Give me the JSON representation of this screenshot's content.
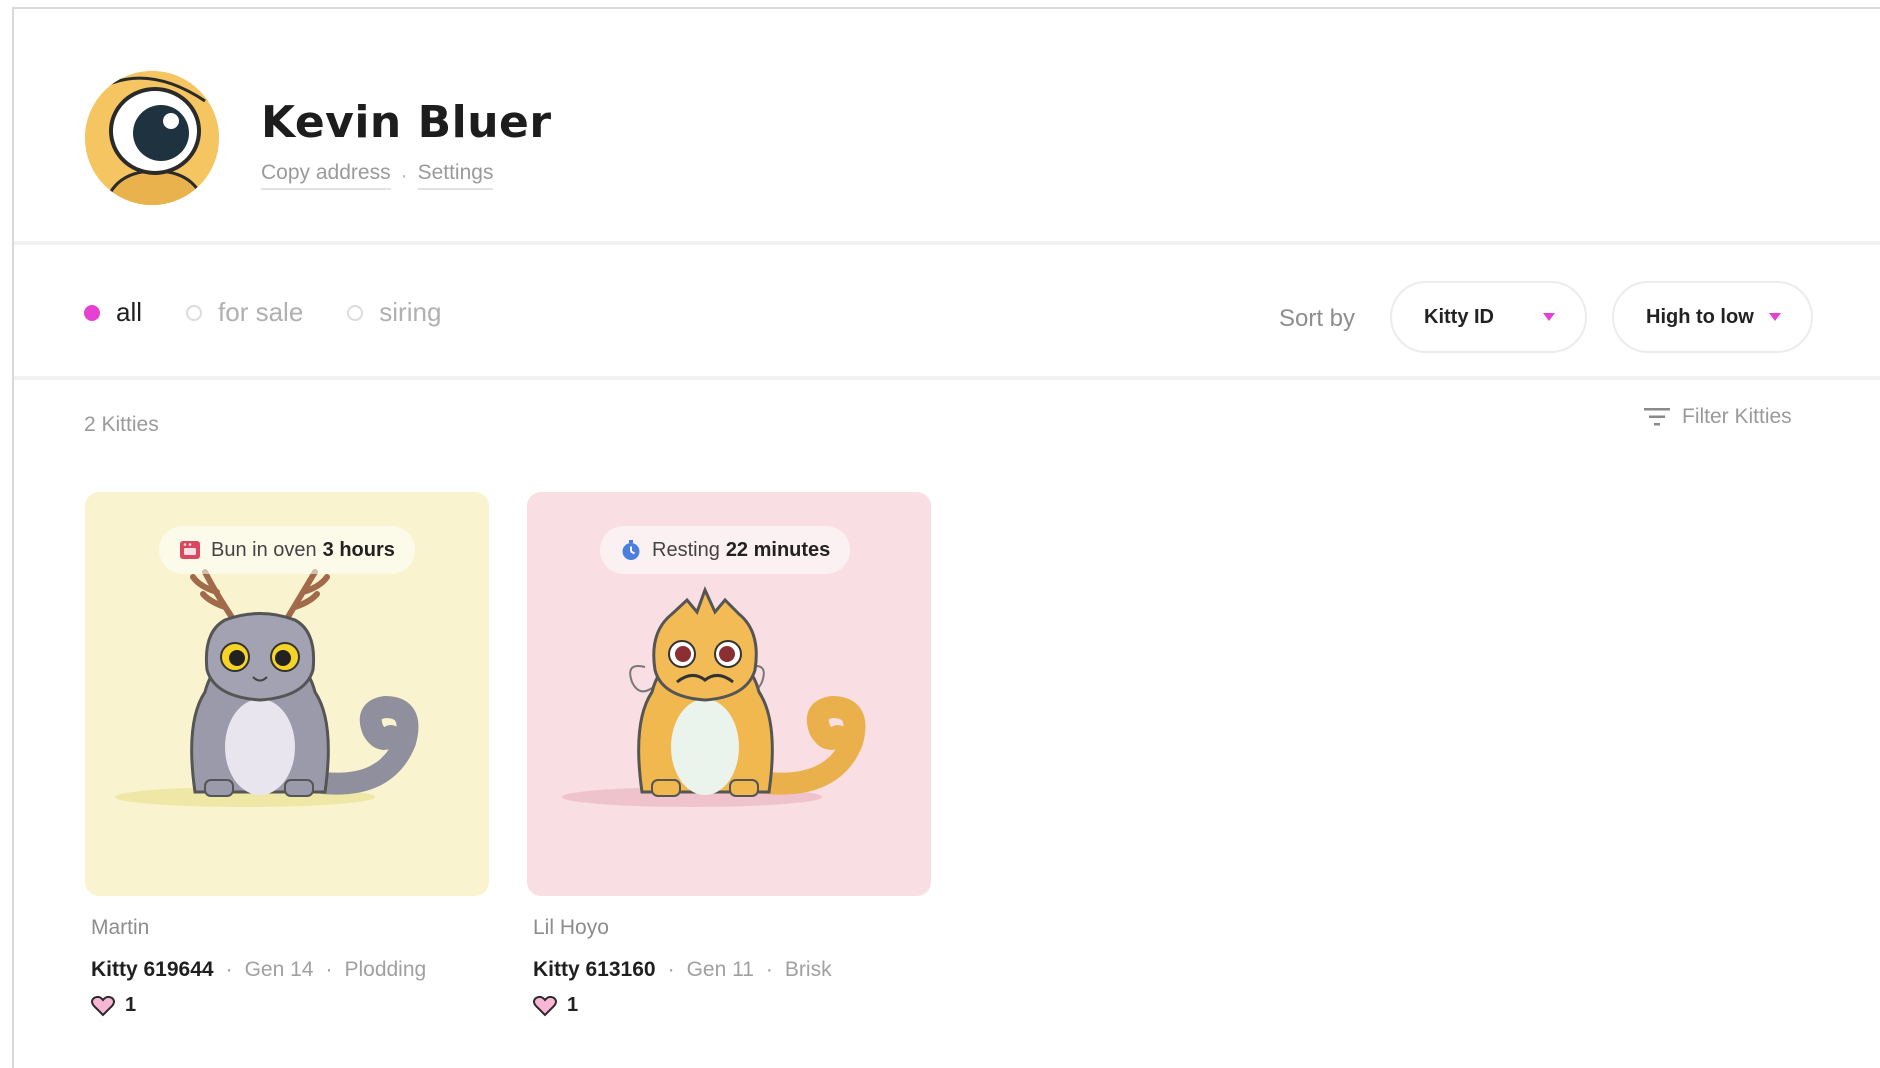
{
  "profile": {
    "name": "Kevin Bluer",
    "copy_address": "Copy address",
    "separator": "·",
    "settings": "Settings"
  },
  "tabs": [
    {
      "label": "all",
      "active": true
    },
    {
      "label": "for sale",
      "active": false
    },
    {
      "label": "siring",
      "active": false
    }
  ],
  "sort": {
    "label": "Sort by",
    "field": "Kitty ID",
    "order": "High to low"
  },
  "count_label": "2 Kitties",
  "filter_label": "Filter Kitties",
  "kitties": [
    {
      "status_prefix": "Bun in oven",
      "status_value": "3 hours",
      "status_icon": "oven-icon",
      "name": "Martin",
      "id": "Kitty 619644",
      "gen": "Gen 14",
      "speed": "Plodding",
      "likes": "1",
      "background": "#f9f4cf"
    },
    {
      "status_prefix": "Resting",
      "status_value": "22 minutes",
      "status_icon": "stopwatch-icon",
      "name": "Lil Hoyo",
      "id": "Kitty 613160",
      "gen": "Gen 11",
      "speed": "Brisk",
      "likes": "1",
      "background": "#f9dfe3"
    }
  ],
  "colors": {
    "accent": "#e541d3",
    "muted_text": "#9a9a9a"
  }
}
